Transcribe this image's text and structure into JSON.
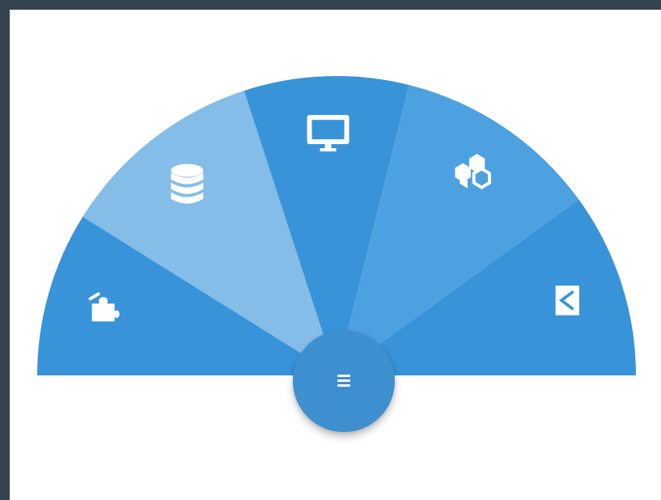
{
  "colors": {
    "page_border": "#34444f",
    "canvas": "#ffffff",
    "toggle_button": "#3d8fd0",
    "icon": "#ffffff"
  },
  "menu": {
    "toggle_icon": "hamburger-icon",
    "items": [
      {
        "id": "puzzle",
        "icon": "puzzle-icon",
        "color": "#3893d9"
      },
      {
        "id": "database",
        "icon": "database-icon",
        "color": "#84bde8"
      },
      {
        "id": "monitor",
        "icon": "monitor-icon",
        "color": "#3893d9"
      },
      {
        "id": "cubes",
        "icon": "cubes-icon",
        "color": "#4ea1e0"
      },
      {
        "id": "kotlin",
        "icon": "kotlin-icon",
        "color": "#3893d9"
      }
    ]
  }
}
